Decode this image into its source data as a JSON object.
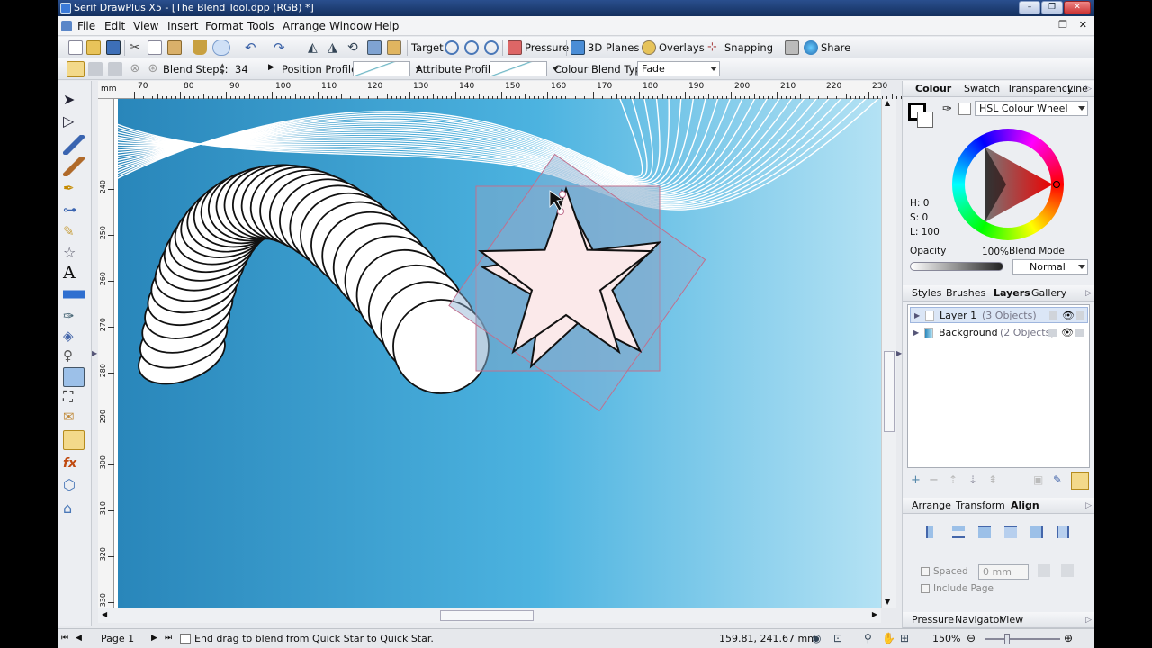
{
  "window": {
    "title": "Serif DrawPlus X5 - [The Blend Tool.dpp (RGB) *]",
    "controls": [
      "–",
      "❐",
      "✕"
    ]
  },
  "menu": [
    "File",
    "Edit",
    "View",
    "Insert",
    "Format",
    "Tools",
    "Arrange",
    "Window",
    "Help"
  ],
  "toolbar": {
    "target_label": "Target",
    "pressure_label": "Pressure",
    "planes_label": "3D Planes",
    "overlays_label": "Overlays",
    "snapping_label": "Snapping",
    "share_label": "Share"
  },
  "context_bar": {
    "blend_steps_label": "Blend Steps:",
    "blend_steps_value": "34",
    "position_profile_label": "Position Profile:",
    "attribute_profile_label": "Attribute Profile:",
    "colour_blend_label": "Colour Blend Type:",
    "colour_blend_value": "Fade"
  },
  "ruler": {
    "unit": "mm",
    "h_ticks": [
      "70",
      "80",
      "90",
      "100",
      "110",
      "120",
      "130",
      "140",
      "150",
      "160",
      "170",
      "180",
      "190",
      "200",
      "210",
      "220",
      "230"
    ],
    "v_ticks": [
      "240",
      "250",
      "260",
      "270",
      "280",
      "290",
      "300",
      "310",
      "320",
      "330"
    ]
  },
  "status": {
    "page_label": "Page 1",
    "message": "End drag to blend from Quick Star to Quick Star.",
    "coords": "159.81, 241.67 mm",
    "zoom": "150%"
  },
  "colour_panel": {
    "tabs": [
      "Colour",
      "Swatch",
      "Transparency",
      "Line"
    ],
    "active_tab": "Colour",
    "model": "HSL Colour Wheel",
    "h": "H: 0",
    "s": "S: 0",
    "l": "L: 100",
    "opacity_label": "Opacity",
    "opacity_value": "100%",
    "blend_mode_label": "Blend Mode",
    "blend_mode_value": "Normal"
  },
  "layers_panel": {
    "tabs": [
      "Styles",
      "Brushes",
      "Layers",
      "Gallery"
    ],
    "active_tab": "Layers",
    "layers": [
      {
        "name": "Layer 1",
        "count": "(3 Objects)"
      },
      {
        "name": "Background",
        "count": "(2 Objects)"
      }
    ]
  },
  "align_panel": {
    "tabs": [
      "Arrange",
      "Transform",
      "Align"
    ],
    "active_tab": "Align",
    "spaced_label": "Spaced",
    "spaced_value": "0 mm",
    "include_page_label": "Include Page"
  },
  "bottom_panel": {
    "tabs": [
      "Pressure",
      "Navigator",
      "View"
    ]
  },
  "colors": {
    "titlebar": "#1d3f78",
    "accent_sky_dark": "#2d8ec2",
    "accent_sky_light": "#b4e2f4",
    "star_fill": "#fbe9ea"
  }
}
